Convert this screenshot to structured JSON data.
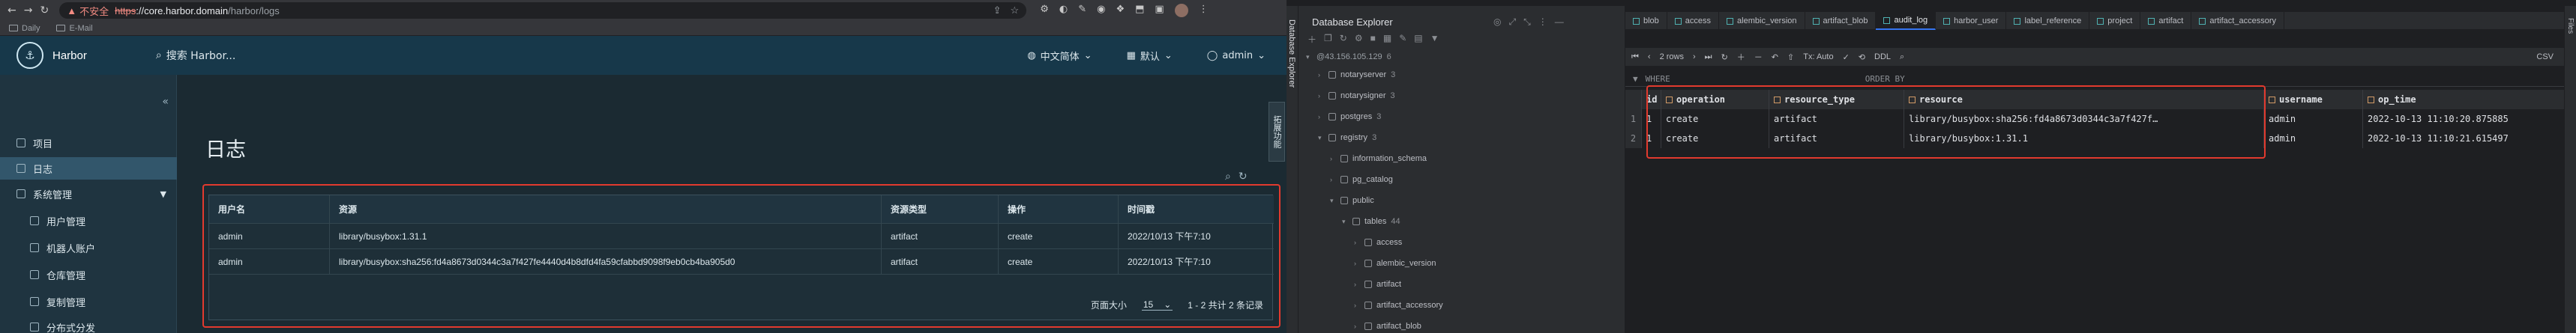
{
  "browser": {
    "insecure_label": "不安全",
    "url_protocol": "https",
    "url_host": "://core.harbor.domain",
    "url_path": "/harbor/logs",
    "bookmarks": [
      "Daily",
      "E-Mail"
    ]
  },
  "harbor": {
    "brand": "Harbor",
    "search_placeholder": "搜索 Harbor...",
    "language": "中文简体",
    "theme": "默认",
    "user": "admin",
    "nav": {
      "projects": "项目",
      "logs": "日志",
      "system_admin": "系统管理",
      "user_admin": "用户管理",
      "robot_accounts": "机器人账户",
      "registries": "仓库管理",
      "replications": "复制管理",
      "distributions": "分布式分发"
    },
    "page_title": "日志",
    "side_tab": "拓展功能",
    "table": {
      "headers": [
        "用户名",
        "资源",
        "资源类型",
        "操作",
        "时间戳"
      ],
      "rows": [
        [
          "admin",
          "library/busybox:1.31.1",
          "artifact",
          "create",
          "2022/10/13 下午7:10"
        ],
        [
          "admin",
          "library/busybox:sha256:fd4a8673d0344c3a7f427fe4440d4b8dfd4fa59cfabbd9098f9eb0cb4ba905d0",
          "artifact",
          "create",
          "2022/10/13 下午7:10"
        ]
      ],
      "page_size_label": "页面大小",
      "page_size": "15",
      "pagination_text": "1 - 2 共计 2 条记录"
    }
  },
  "ide": {
    "top_crumbs": "Database Explorer",
    "panel_title": "Database Explorer",
    "server": "@43.156.105.129",
    "server_count": "6",
    "tree": [
      {
        "label": "notaryserver",
        "count": "3"
      },
      {
        "label": "notarysigner",
        "count": "3"
      },
      {
        "label": "postgres",
        "count": "3"
      },
      {
        "label": "registry",
        "count": "3"
      },
      {
        "label": "information_schema",
        "count": ""
      },
      {
        "label": "pg_catalog",
        "count": ""
      },
      {
        "label": "public",
        "count": ""
      },
      {
        "label": "tables",
        "count": "44"
      },
      {
        "label": "access",
        "count": ""
      },
      {
        "label": "alembic_version",
        "count": ""
      },
      {
        "label": "artifact",
        "count": ""
      },
      {
        "label": "artifact_accessory",
        "count": ""
      },
      {
        "label": "artifact_blob",
        "count": ""
      }
    ],
    "tabs": [
      "blob",
      "access",
      "alembic_version",
      "artifact_blob",
      "audit_log",
      "harbor_user",
      "label_reference",
      "project",
      "artifact",
      "artifact_accessory"
    ],
    "active_tab": "audit_log",
    "rows_label": "2 rows",
    "tx_label": "Tx: Auto",
    "ddl_label": "DDL",
    "csv_label": "CSV",
    "where_label": "WHERE",
    "order_label": "ORDER BY",
    "right_strip_label": "Files",
    "columns": [
      "id",
      "operation",
      "resource_type",
      "resource",
      "username",
      "op_time"
    ],
    "rows": [
      {
        "num": "1",
        "id": "1",
        "operation": "create",
        "resource_type": "artifact",
        "resource": "library/busybox:sha256:fd4a8673d0344c3a7f427f…",
        "username": "admin",
        "op_time": "2022-10-13 11:10:20.875885"
      },
      {
        "num": "2",
        "id": "1",
        "operation": "create",
        "resource_type": "artifact",
        "resource": "library/busybox:1.31.1",
        "username": "admin",
        "op_time": "2022-10-13 11:10:21.615497"
      }
    ]
  }
}
